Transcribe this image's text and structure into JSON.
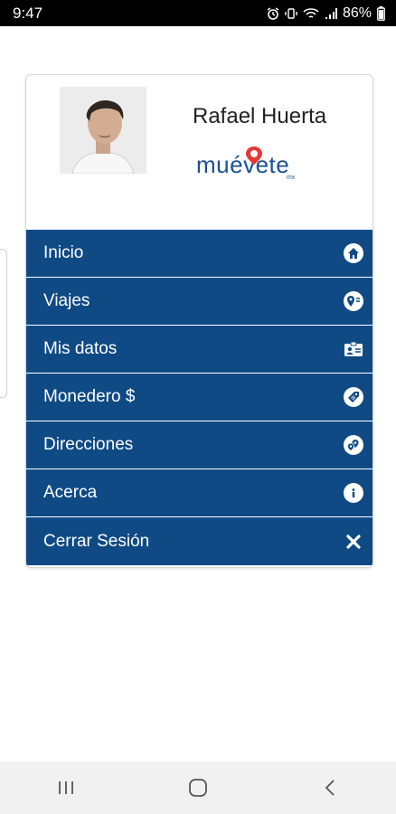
{
  "status_bar": {
    "time": "9:47",
    "battery": "86%",
    "icons": [
      "alarm-icon",
      "vibrate-icon",
      "wifi-icon",
      "signal-icon",
      "battery-icon"
    ]
  },
  "profile": {
    "name": "Rafael Huerta",
    "logo_text": "muévete",
    "logo_suffix": "mx"
  },
  "menu": {
    "items": [
      {
        "label": "Inicio",
        "icon": "home-icon"
      },
      {
        "label": "Viajes",
        "icon": "route-pin-icon"
      },
      {
        "label": "Mis datos",
        "icon": "id-card-icon"
      },
      {
        "label": "Monedero $",
        "icon": "tag-icon"
      },
      {
        "label": "Direcciones",
        "icon": "location-pins-icon"
      },
      {
        "label": "Acerca",
        "icon": "info-icon"
      },
      {
        "label": "Cerrar Sesión",
        "icon": "close-icon"
      }
    ]
  },
  "colors": {
    "menu_bg": "#0f4a85",
    "brand_blue": "#1b4f94",
    "brand_red": "#e53935"
  },
  "nav_bar": {
    "icons": [
      "recent-apps-icon",
      "home-button-icon",
      "back-icon"
    ]
  }
}
